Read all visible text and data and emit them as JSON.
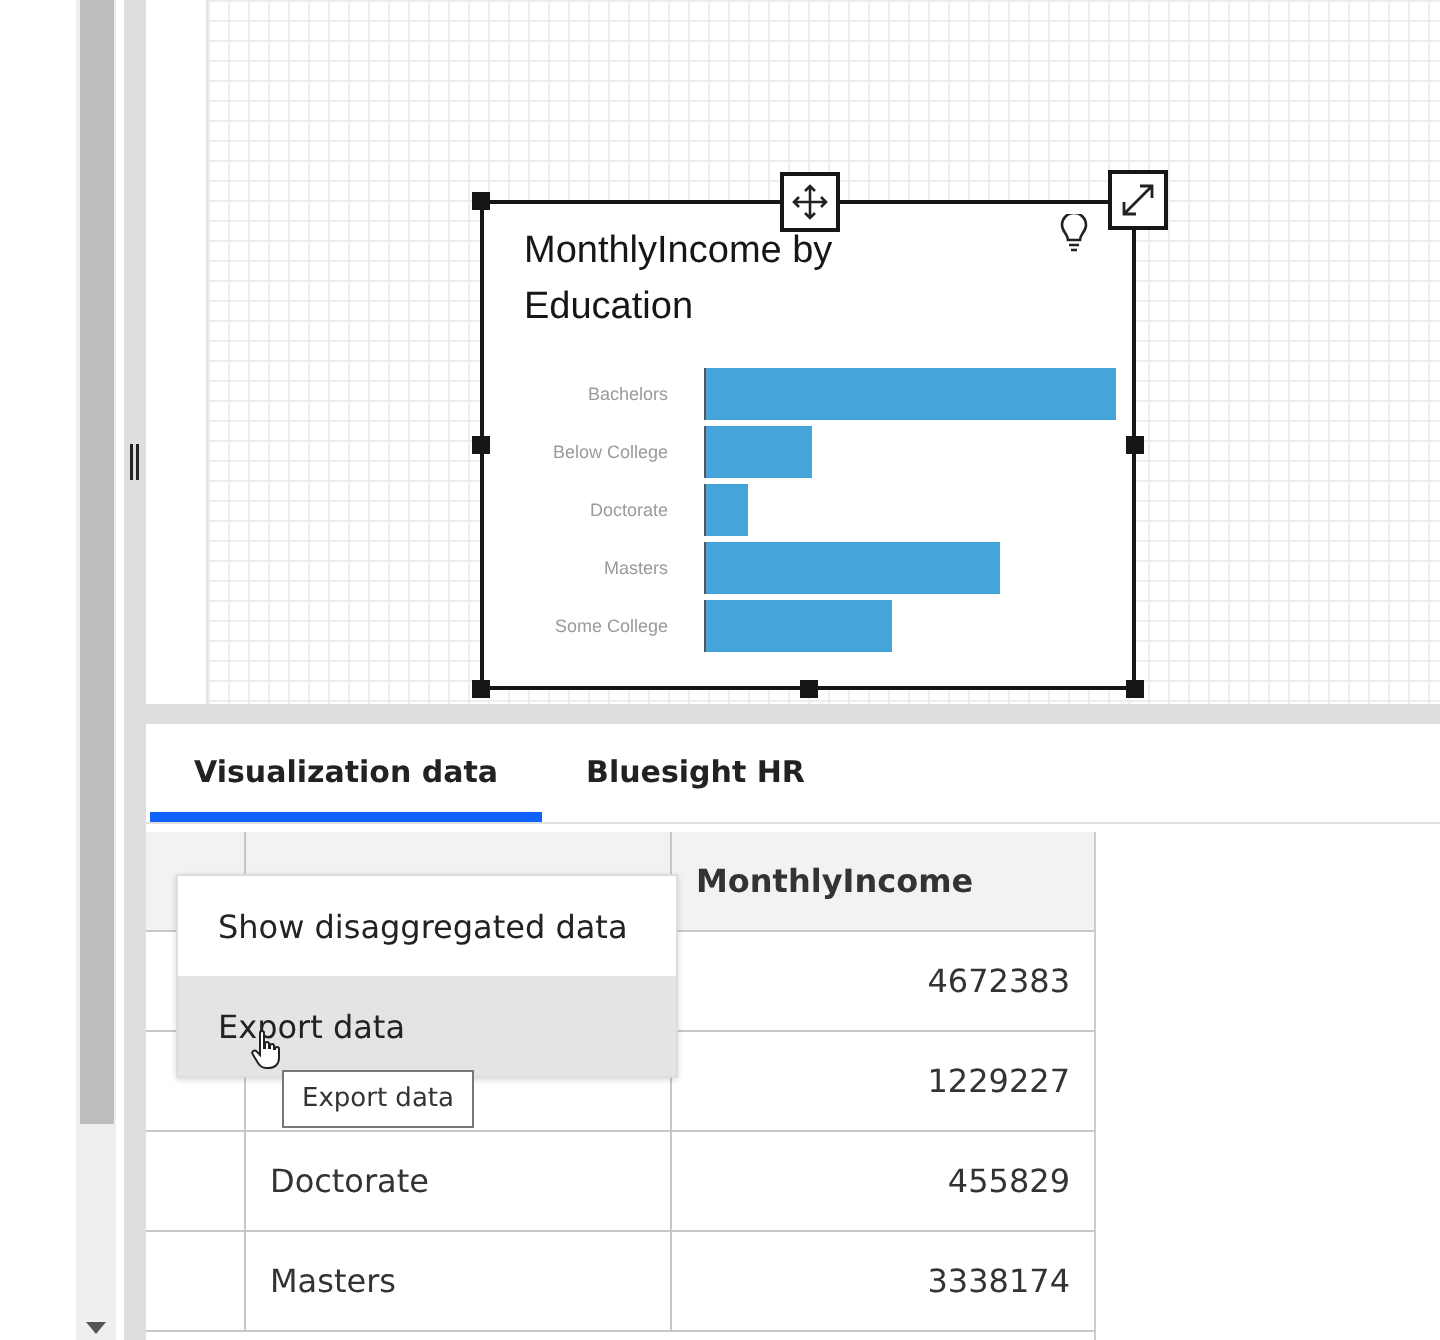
{
  "canvas": {
    "widget": {
      "title": "MonthlyIncome by Education",
      "bars": [
        {
          "label": "Bachelors",
          "level": 1
        },
        {
          "label": "Below College",
          "level": 0.26
        },
        {
          "label": "Doctorate",
          "level": 0.1
        },
        {
          "label": "Masters",
          "level": 0.715
        },
        {
          "label": "Some College",
          "level": 0.455
        }
      ]
    }
  },
  "tabs": [
    {
      "label": "Visualization data",
      "selected": true
    },
    {
      "label": "Bluesight HR",
      "selected": false
    }
  ],
  "table": {
    "header": {
      "column_3": "MonthlyIncome"
    },
    "rows": [
      {
        "column_3": "4672383"
      },
      {
        "column_3": "1229227"
      },
      {
        "column_2": "Doctorate",
        "column_3": "455829"
      },
      {
        "column_2": "Masters",
        "column_3": "3338174"
      }
    ]
  },
  "context_menu": {
    "items": [
      {
        "label": "Show disaggregated data",
        "selected": false
      },
      {
        "label": "Export data",
        "selected": true
      }
    ]
  },
  "tooltip": "Export data"
}
